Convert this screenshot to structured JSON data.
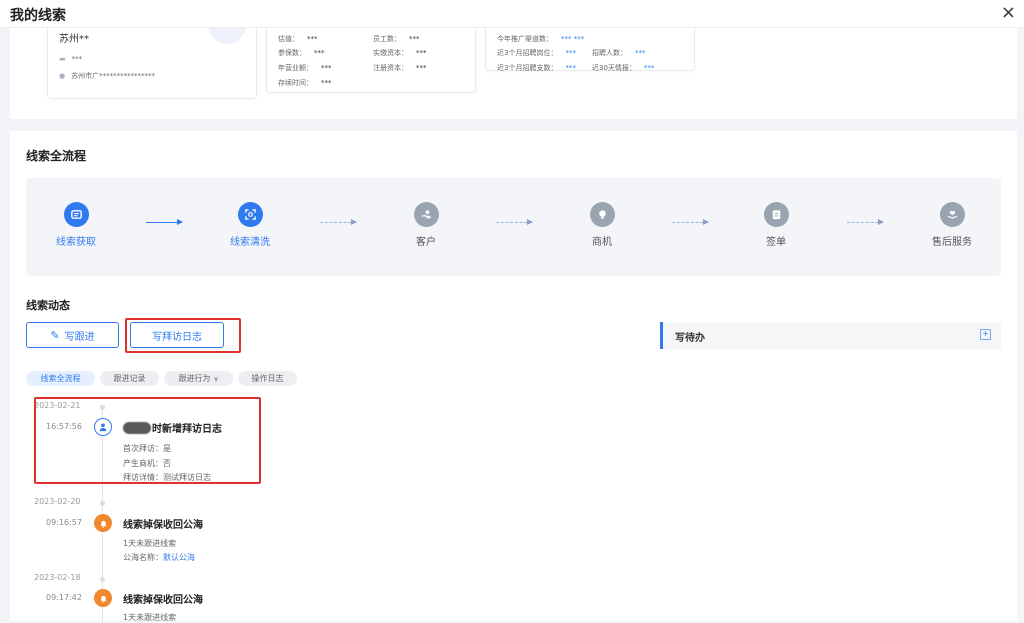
{
  "header": {
    "title": "我的线索",
    "close_icon": "×"
  },
  "company_card": {
    "name": "苏州**",
    "phone": "***",
    "address": "苏州市广****************"
  },
  "finance_card": [
    {
      "label": "估值：",
      "value": "***"
    },
    {
      "label": "员工数：",
      "value": "***"
    },
    {
      "label": "参保数：",
      "value": "***"
    },
    {
      "label": "实缴资本：",
      "value": "***"
    },
    {
      "label": "年营业额：",
      "value": "***"
    },
    {
      "label": "注册资本：",
      "value": "***"
    },
    {
      "label": "存续时间：",
      "value": "***"
    }
  ],
  "recruit_card": [
    {
      "label": "今年推广渠道数：",
      "value": "*** ***"
    },
    {
      "label": "近3个月招聘岗位：",
      "value": "***"
    },
    {
      "label": "招聘人数：",
      "value": "***"
    },
    {
      "label": "近3个月招聘支数：",
      "value": "***"
    },
    {
      "label": "近30天情报：",
      "value": "***"
    }
  ],
  "process": {
    "title": "线索全流程",
    "steps": [
      {
        "label": "线索获取",
        "icon": "ticket-icon",
        "active": true
      },
      {
        "label": "线索清洗",
        "icon": "scan-icon",
        "active": true
      },
      {
        "label": "客户",
        "icon": "hand-icon",
        "active": false
      },
      {
        "label": "商机",
        "icon": "lightbulb-icon",
        "active": false
      },
      {
        "label": "签单",
        "icon": "clipboard-icon",
        "active": false
      },
      {
        "label": "售后服务",
        "icon": "heart-hand-icon",
        "active": false
      }
    ]
  },
  "activity": {
    "title": "线索动态",
    "write_follow": "写跟进",
    "write_visit": "写拜访日志",
    "todo": "写待办",
    "filters": [
      "线索全流程",
      "跟进记录",
      "跟进行为",
      "操作日志"
    ]
  },
  "timeline": [
    {
      "date": "2023-02-21",
      "time": "16:57:56",
      "icon": "user-icon",
      "title": "时新增拜访日志",
      "lines": [
        {
          "label": "首次拜访：",
          "value": "是"
        },
        {
          "label": "产生商机：",
          "value": "否"
        },
        {
          "label": "拜访详情：",
          "value": "测试拜访日志"
        }
      ]
    },
    {
      "date": "2023-02-20",
      "time": "09:16:57",
      "icon": "bell-icon",
      "title": "线索掉保收回公海",
      "lines": [
        {
          "label": "",
          "value": "1天未跟进线索"
        },
        {
          "label": "公海名称：",
          "value": "默认公海"
        }
      ]
    },
    {
      "date": "2023-02-18",
      "time": "09:17:42",
      "icon": "bell-icon",
      "title": "线索掉保收回公海",
      "lines": [
        {
          "label": "",
          "value": "1天未跟进线索"
        }
      ]
    }
  ],
  "colors": {
    "accent": "#2f7af0",
    "inactive": "#9aa3b0",
    "warning": "#f0892b",
    "highlight": "#e03131"
  }
}
